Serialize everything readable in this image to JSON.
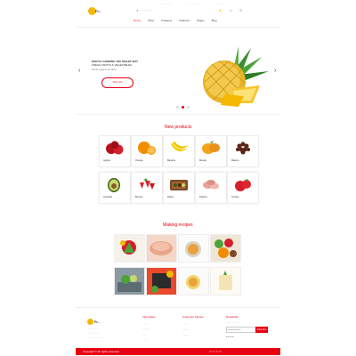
{
  "header": {
    "logo_text": "Fr...",
    "topbar": [
      "·····  ·········",
      "·····  ·········",
      "···  ·····  ···"
    ],
    "nav": [
      "Home",
      "Shop",
      "Category",
      "Features",
      "Pages",
      "Blog"
    ],
    "active_nav_index": 0
  },
  "hero": {
    "line1": "DIGITAL FARMING THE SMART WAY",
    "line2": "FRESH FRUITS & VEGETABLES",
    "line3": "Fresh organic produce",
    "button": "Shop now"
  },
  "new_products": {
    "title": "New products",
    "items": [
      {
        "label": "Apples"
      },
      {
        "label": "Orange"
      },
      {
        "label": "Banana"
      },
      {
        "label": "Mango"
      },
      {
        "label": "Raisins"
      },
      {
        "label": "Avocado"
      },
      {
        "label": "Berries"
      },
      {
        "label": "Dates"
      },
      {
        "label": "Prawns"
      },
      {
        "label": "Tomato"
      }
    ]
  },
  "recipes": {
    "title": "Making recipes"
  },
  "footer": {
    "logo_text": "Fr...",
    "col1_title": "Information",
    "col2_title": "Customer Service",
    "col3_title": "Newsletter",
    "newsletter_placeholder": "Email address",
    "newsletter_button": "Subscribe",
    "bottom_text": "Copyright © All rights reserved"
  },
  "colors": {
    "accent": "#e60012",
    "logo": "#f5b800"
  }
}
